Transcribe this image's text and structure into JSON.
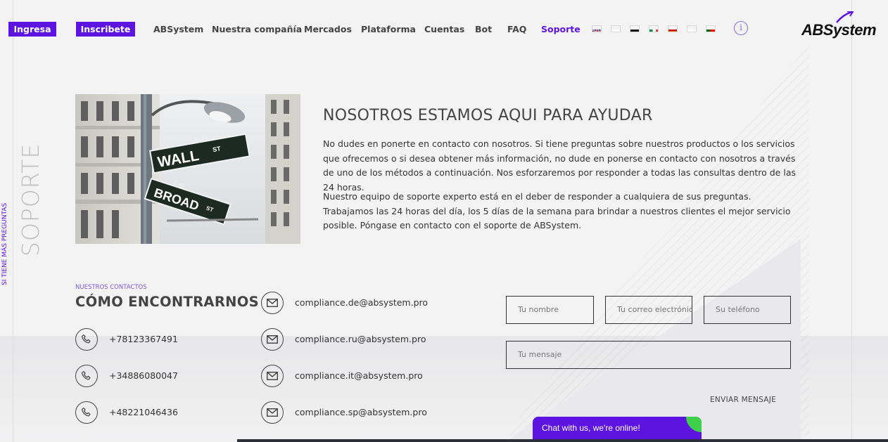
{
  "header": {
    "login_label": "Ingresa",
    "signup_label": "Inscribete",
    "nav": [
      "ABSystem",
      "Nuestra compañía",
      "Mercados",
      "Plataforma",
      "Cuentas",
      "Bot",
      "FAQ",
      "Soporte"
    ],
    "active_nav": "Soporte",
    "languages": [
      "en",
      "ru",
      "de",
      "it",
      "es",
      "pl",
      "pt"
    ],
    "info_icon_glyph": "i",
    "logo_text": "ABSystem"
  },
  "side": {
    "title": "SOPORTE",
    "subtitle": "SI TIENE MÁS PREGUNTAS"
  },
  "photo": {
    "sign_top_small": "11-21",
    "sign_top": "WALL",
    "sign_top_suffix": "ST",
    "sign_bottom_small": "2-49",
    "sign_bottom": "BROAD",
    "sign_bottom_suffix": "ST"
  },
  "intro": {
    "title": "NOSOTROS ESTAMOS AQUI PARA AYUDAR",
    "paragraph1": "No dudes en ponerte en contacto con nosotros. Si tiene preguntas sobre nuestros productos o los servicios que ofrecemos o si desea obtener más información, no dude en ponerse en contacto con nosotros a través de uno de los métodos a continuación. Nos esforzaremos por responder a todas las consultas dentro de las 24 horas.",
    "paragraph2": "Nuestro equipo de soporte experto está en el deber de responder a cualquiera de sus preguntas. Trabajamos las 24 horas del día, los 5 días de la semana para brindar a nuestros clientes el mejor servicio posible. Póngase en contacto con el soporte de ABSystem."
  },
  "contacts": {
    "eyebrow": "NUESTROS CONTACTOS",
    "title": "CÓMO ENCONTRARNOS",
    "phones": [
      "+78123367491",
      "+34886080047",
      "+48221046436"
    ],
    "emails": [
      "compliance.de@absystem.pro",
      "compliance.ru@absystem.pro",
      "compliance.it@absystem.pro",
      "compliance.sp@absystem.pro"
    ]
  },
  "form": {
    "name_placeholder": "Tu nombre",
    "email_placeholder": "Tu correo electrónico",
    "phone_placeholder": "Su teléfono",
    "message_placeholder": "Tu mensaje",
    "submit_label": "ENVIAR MENSAJE"
  },
  "chat": {
    "label": "Chat with us, we're online!"
  },
  "colors": {
    "accent": "#5d14e0",
    "online": "#3fd04b"
  }
}
